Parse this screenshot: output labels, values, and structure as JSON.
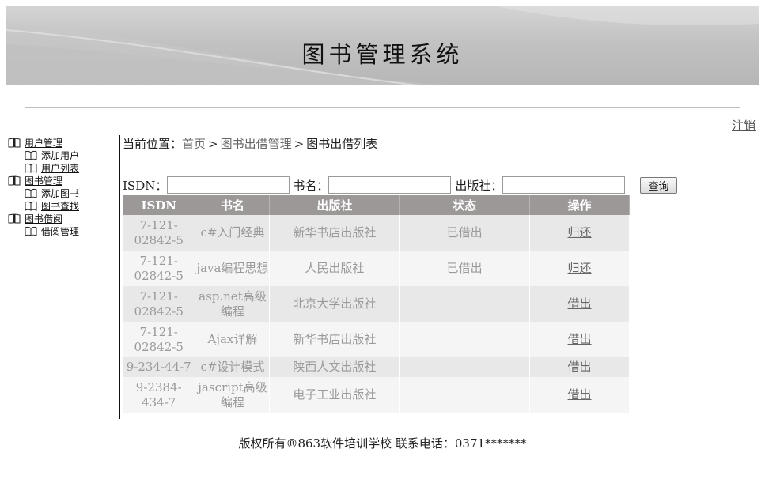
{
  "header": {
    "title": "图书管理系统"
  },
  "logout_label": "注销",
  "sidebar": {
    "groups": [
      {
        "label": "用户管理",
        "items": [
          "添加用户",
          "用户列表"
        ]
      },
      {
        "label": "图书管理",
        "items": [
          "添加图书",
          "图书查找"
        ]
      },
      {
        "label": "图书借阅",
        "items": [
          "借阅管理"
        ]
      }
    ]
  },
  "breadcrumb": {
    "prefix": "当前位置：",
    "home": "首页",
    "sep": ">",
    "section": "图书出借管理",
    "current": "图书出借列表"
  },
  "search": {
    "isdn_label": "ISDN：",
    "isdn_value": "",
    "name_label": "书名：",
    "name_value": "",
    "publisher_label": "出版社：",
    "publisher_value": "",
    "button": "查询"
  },
  "table": {
    "headers": [
      "ISDN",
      "书名",
      "出版社",
      "状态",
      "操作"
    ],
    "rows": [
      {
        "isdn": "7-121-02842-5",
        "name": "c#入门经典",
        "publisher": "新华书店出版社",
        "status": "已借出",
        "action": "归还"
      },
      {
        "isdn": "7-121-02842-5",
        "name": "java编程思想",
        "publisher": "人民出版社",
        "status": "已借出",
        "action": "归还"
      },
      {
        "isdn": "7-121-02842-5",
        "name": "asp.net高级编程",
        "publisher": "北京大学出版社",
        "status": "",
        "action": "借出"
      },
      {
        "isdn": "7-121-02842-5",
        "name": "Ajax详解",
        "publisher": "新华书店出版社",
        "status": "",
        "action": "借出"
      },
      {
        "isdn": "9-234-44-7",
        "name": "c#设计模式",
        "publisher": "陕西人文出版社",
        "status": "",
        "action": "借出"
      },
      {
        "isdn": "9-2384-434-7",
        "name": "jascript高级编程",
        "publisher": "电子工业出版社",
        "status": "",
        "action": "借出"
      }
    ]
  },
  "footer": {
    "text": "版权所有®863软件培训学校 联系电话：0371*******"
  }
}
